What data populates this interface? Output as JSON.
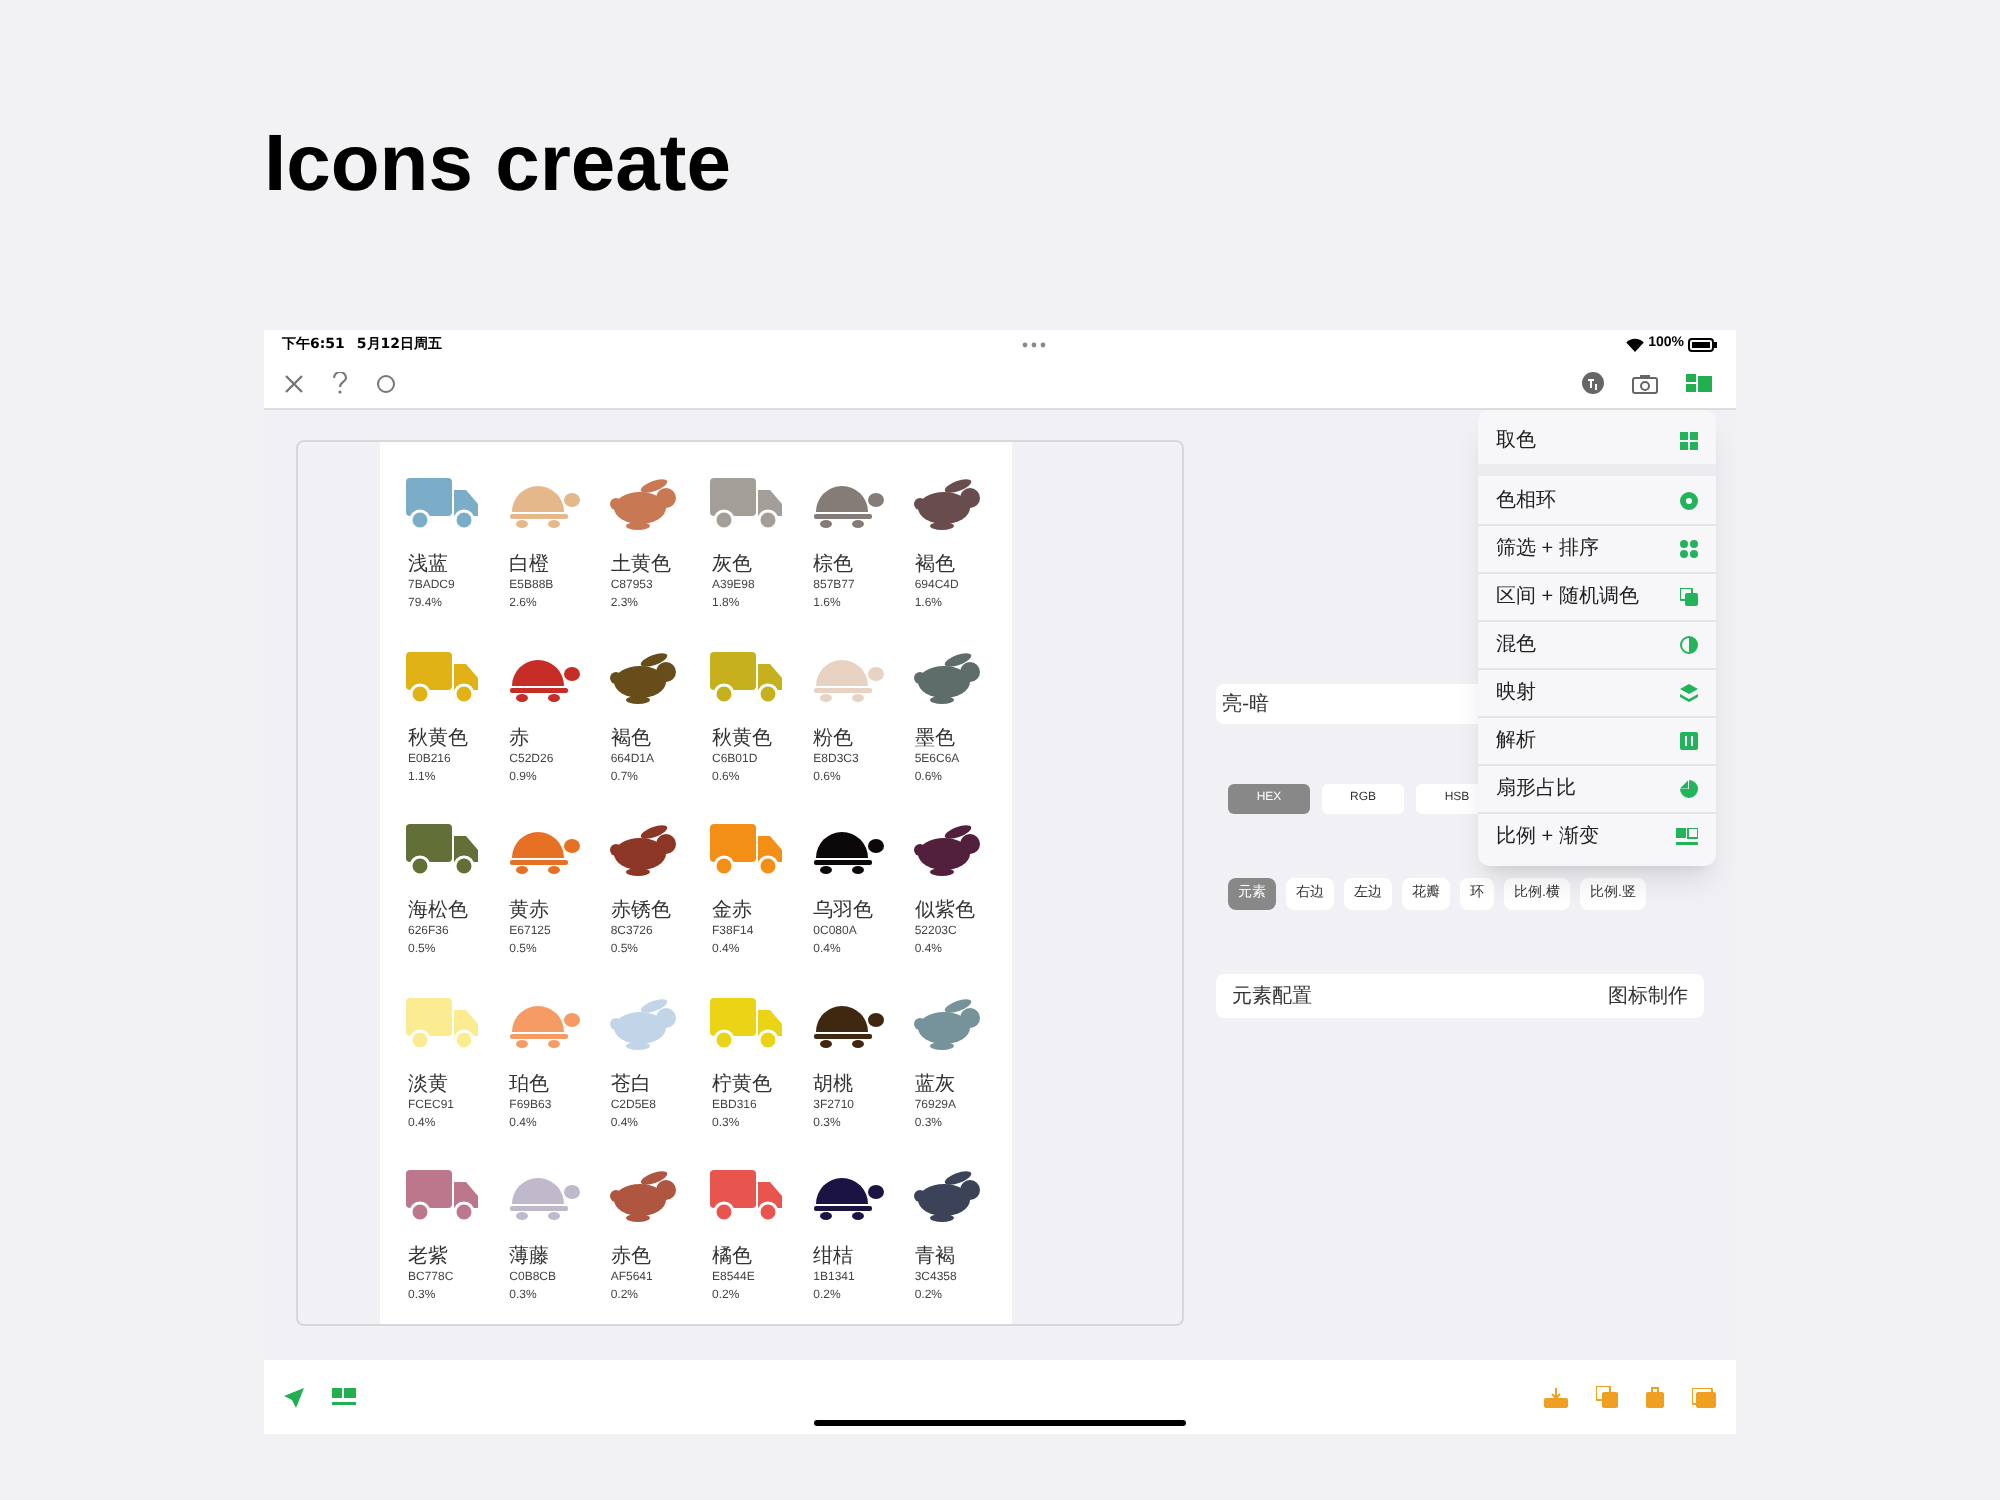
{
  "headline": "Icons create",
  "status_bar": {
    "time": "下午6:51",
    "date": "5月12日周五",
    "battery": "100%"
  },
  "swatches": [
    {
      "kind": "truck",
      "name": "浅蓝",
      "hex": "7BADC9",
      "share": "79.4%",
      "color": "#7badc9"
    },
    {
      "kind": "turtle",
      "name": "白橙",
      "hex": "E5B88B",
      "share": "2.6%",
      "color": "#e5b88b"
    },
    {
      "kind": "rabbit",
      "name": "土黄色",
      "hex": "C87953",
      "share": "2.3%",
      "color": "#c87953"
    },
    {
      "kind": "truck",
      "name": "灰色",
      "hex": "A39E98",
      "share": "1.8%",
      "color": "#a39e98"
    },
    {
      "kind": "turtle",
      "name": "棕色",
      "hex": "857B77",
      "share": "1.6%",
      "color": "#857b77"
    },
    {
      "kind": "rabbit",
      "name": "褐色",
      "hex": "694C4D",
      "share": "1.6%",
      "color": "#694c4d"
    },
    {
      "kind": "truck",
      "name": "秋黄色",
      "hex": "E0B216",
      "share": "1.1%",
      "color": "#e0b216"
    },
    {
      "kind": "turtle",
      "name": "赤",
      "hex": "C52D26",
      "share": "0.9%",
      "color": "#c52d26"
    },
    {
      "kind": "rabbit",
      "name": "褐色",
      "hex": "664D1A",
      "share": "0.7%",
      "color": "#664d1a"
    },
    {
      "kind": "truck",
      "name": "秋黄色",
      "hex": "C6B01D",
      "share": "0.6%",
      "color": "#c6b01d"
    },
    {
      "kind": "turtle",
      "name": "粉色",
      "hex": "E8D3C3",
      "share": "0.6%",
      "color": "#e8d3c3"
    },
    {
      "kind": "rabbit",
      "name": "墨色",
      "hex": "5E6C6A",
      "share": "0.6%",
      "color": "#5e6c6a"
    },
    {
      "kind": "truck",
      "name": "海松色",
      "hex": "626F36",
      "share": "0.5%",
      "color": "#626f36"
    },
    {
      "kind": "turtle",
      "name": "黄赤",
      "hex": "E67125",
      "share": "0.5%",
      "color": "#e67125"
    },
    {
      "kind": "rabbit",
      "name": "赤锈色",
      "hex": "8C3726",
      "share": "0.5%",
      "color": "#8c3726"
    },
    {
      "kind": "truck",
      "name": "金赤",
      "hex": "F38F14",
      "share": "0.4%",
      "color": "#f38f14"
    },
    {
      "kind": "turtle",
      "name": "乌羽色",
      "hex": "0C080A",
      "share": "0.4%",
      "color": "#0c080a"
    },
    {
      "kind": "rabbit",
      "name": "似紫色",
      "hex": "52203C",
      "share": "0.4%",
      "color": "#52203c"
    },
    {
      "kind": "truck",
      "name": "淡黄",
      "hex": "FCEC91",
      "share": "0.4%",
      "color": "#fcec91"
    },
    {
      "kind": "turtle",
      "name": "珀色",
      "hex": "F69B63",
      "share": "0.4%",
      "color": "#f69b63"
    },
    {
      "kind": "rabbit",
      "name": "苍白",
      "hex": "C2D5E8",
      "share": "0.4%",
      "color": "#c2d5e8"
    },
    {
      "kind": "truck",
      "name": "柠黄色",
      "hex": "EBD316",
      "share": "0.3%",
      "color": "#ebd316"
    },
    {
      "kind": "turtle",
      "name": "胡桃",
      "hex": "3F2710",
      "share": "0.3%",
      "color": "#3f2710"
    },
    {
      "kind": "rabbit",
      "name": "蓝灰",
      "hex": "76929A",
      "share": "0.3%",
      "color": "#76929a"
    },
    {
      "kind": "truck",
      "name": "老紫",
      "hex": "BC778C",
      "share": "0.3%",
      "color": "#bc778c"
    },
    {
      "kind": "turtle",
      "name": "薄藤",
      "hex": "C0B8CB",
      "share": "0.3%",
      "color": "#c0b8cb"
    },
    {
      "kind": "rabbit",
      "name": "赤色",
      "hex": "AF5641",
      "share": "0.2%",
      "color": "#af5641"
    },
    {
      "kind": "truck",
      "name": "橘色",
      "hex": "E8544E",
      "share": "0.2%",
      "color": "#e8544e"
    },
    {
      "kind": "turtle",
      "name": "绀桔",
      "hex": "1B1341",
      "share": "0.2%",
      "color": "#1b1341"
    },
    {
      "kind": "rabbit",
      "name": "青褐",
      "hex": "3C4358",
      "share": "0.2%",
      "color": "#3c4358"
    }
  ],
  "mode_row": {
    "label": "亮-暗"
  },
  "format_tabs": [
    {
      "label": "HEX",
      "selected": true
    },
    {
      "label": "RGB",
      "selected": false
    },
    {
      "label": "HSB",
      "selected": false
    }
  ],
  "element_chips": [
    {
      "label": "元素",
      "selected": true
    },
    {
      "label": "右边",
      "selected": false
    },
    {
      "label": "左边",
      "selected": false
    },
    {
      "label": "花瓣",
      "selected": false
    },
    {
      "label": "环",
      "selected": false
    },
    {
      "label": "比例.横",
      "selected": false
    },
    {
      "label": "比例.竖",
      "selected": false
    }
  ],
  "config_row": {
    "label": "元素配置",
    "value": "图标制作"
  },
  "menu": {
    "sections": [
      [
        {
          "label": "取色",
          "kind": "grid"
        }
      ],
      [
        {
          "label": "色相环",
          "kind": "ring"
        },
        {
          "label": "筛选 + 排序",
          "kind": "dots"
        },
        {
          "label": "区间 + 随机调色",
          "kind": "dice"
        },
        {
          "label": "混色",
          "kind": "half"
        },
        {
          "label": "映射",
          "kind": "layers"
        },
        {
          "label": "解析",
          "kind": "square"
        },
        {
          "label": "扇形占比",
          "kind": "pie"
        },
        {
          "label": "比例 + 渐变",
          "kind": "ratio"
        }
      ]
    ]
  }
}
